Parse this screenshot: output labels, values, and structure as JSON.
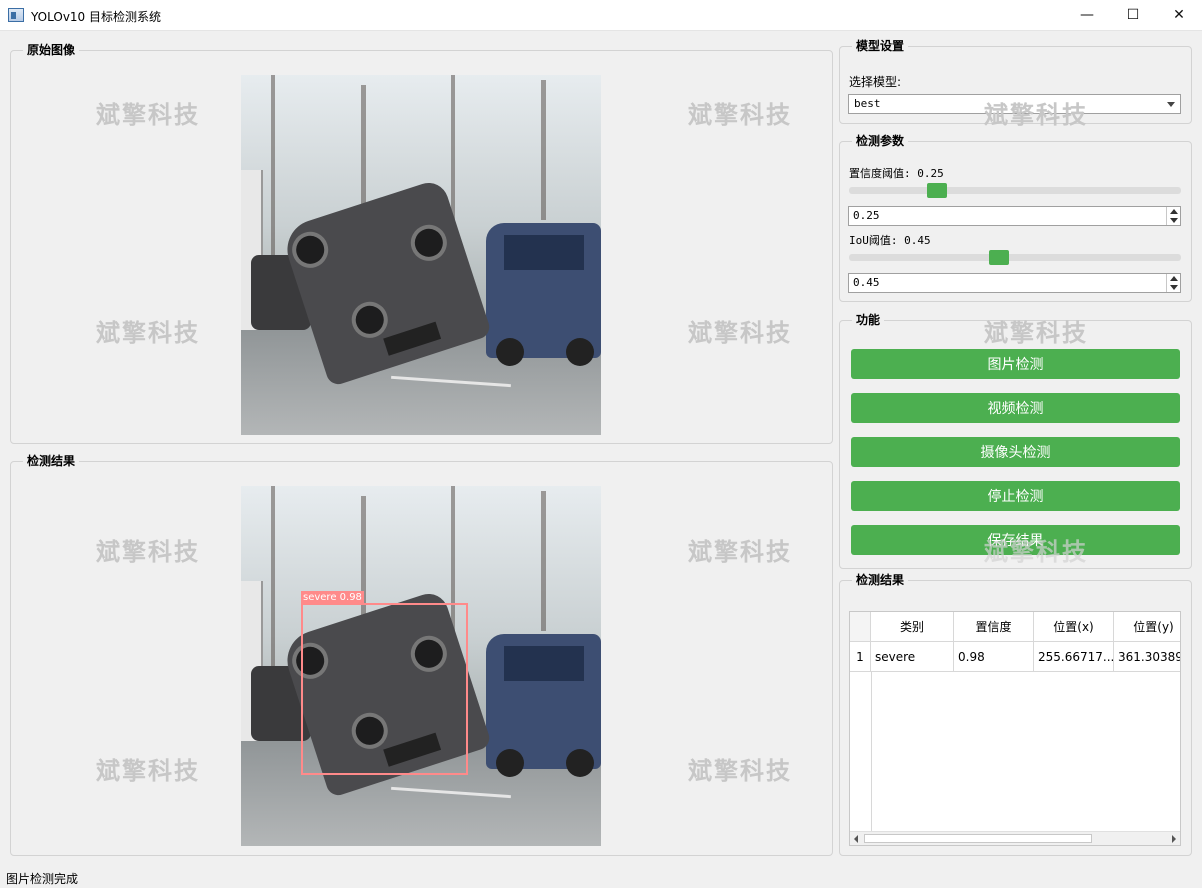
{
  "window": {
    "title": "YOLOv10 目标检测系统",
    "icon": "app-window-icon"
  },
  "original_panel": {
    "title": "原始图像"
  },
  "result_panel": {
    "title": "检测结果"
  },
  "detection": {
    "label": "severe 0.98",
    "box_color": "#ff8a8a"
  },
  "watermark": {
    "text": "斌擎科技"
  },
  "model_settings": {
    "title": "模型设置",
    "select_label": "选择模型:",
    "selected_model": "best"
  },
  "params": {
    "title": "检测参数",
    "conf_label": "置信度阈值: 0.25",
    "conf_value": "0.25",
    "conf_level": 0.25,
    "iou_label": "IoU阈值: 0.45",
    "iou_value": "0.45",
    "iou_level": 0.45
  },
  "functions": {
    "title": "功能",
    "buttons": [
      "图片检测",
      "视频检测",
      "摄像头检测",
      "停止检测",
      "保存结果"
    ],
    "button_color": "#4caf50"
  },
  "results": {
    "title": "检测结果",
    "columns": [
      "类别",
      "置信度",
      "位置(x)",
      "位置(y)"
    ],
    "rows": [
      {
        "index": "1",
        "class": "severe",
        "conf": "0.98",
        "x": "255.66717...",
        "y": "361.30389..."
      }
    ]
  },
  "status": {
    "text": "图片检测完成"
  }
}
